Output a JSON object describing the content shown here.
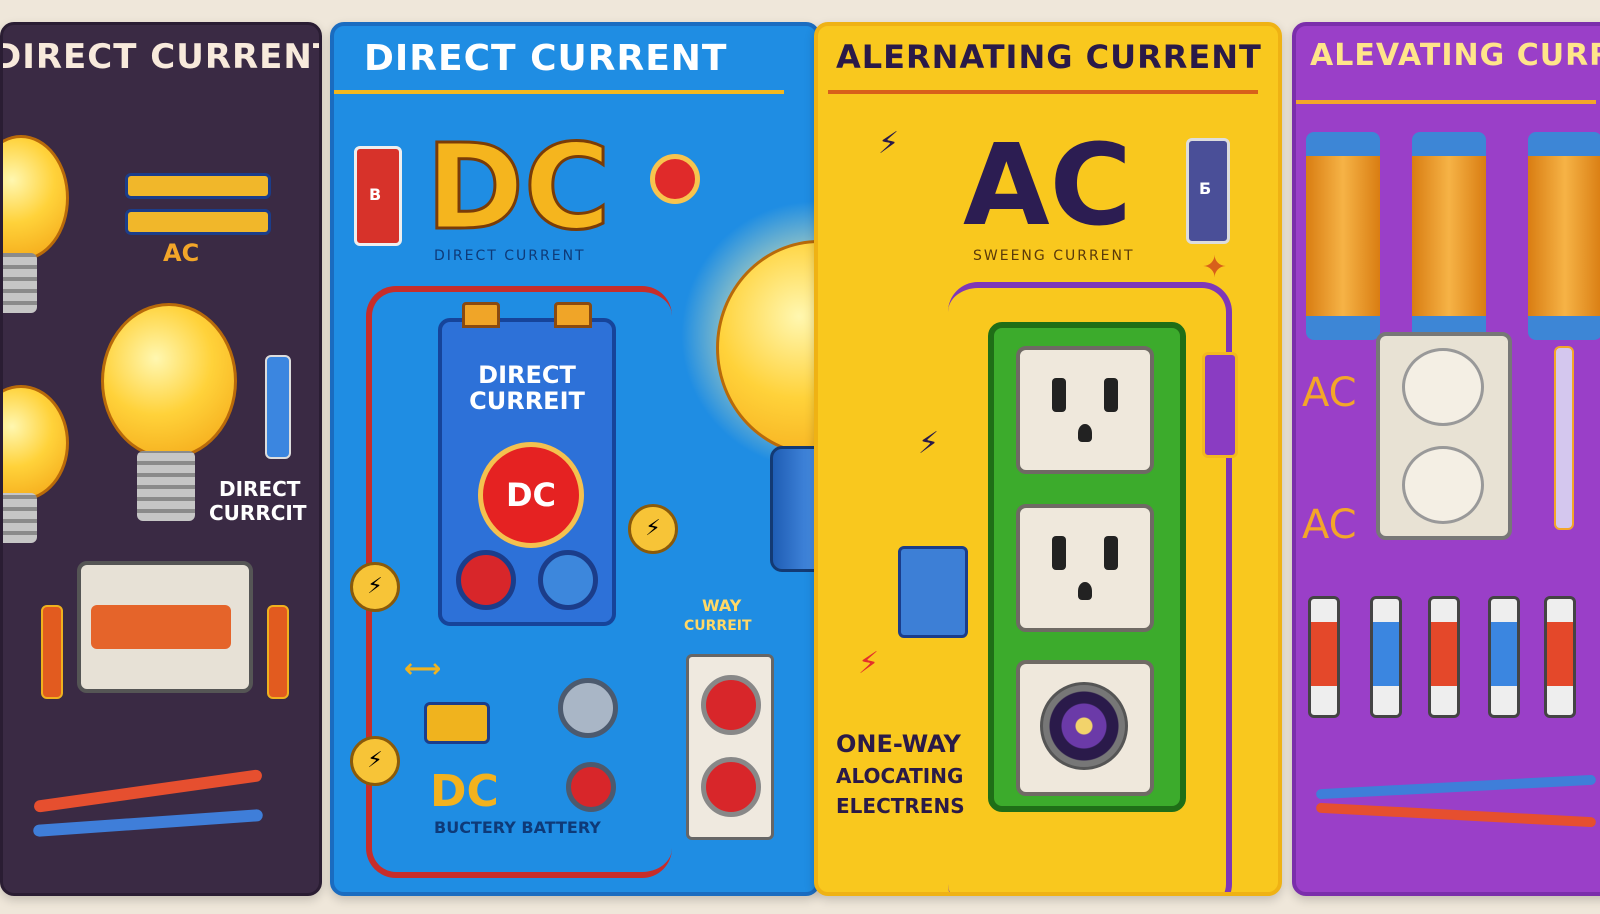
{
  "panels": {
    "p1": {
      "title": "DIRECT CURRENT",
      "label_ac": "AC",
      "label_direct": "DIRECT",
      "label_curr": "CURRCIT"
    },
    "p2": {
      "title": "DIRECT CURRENT",
      "big": "DC",
      "caption": "DIRECT CURRENT",
      "battery_label": "DIRECT CURREIT",
      "button": "DC",
      "way": "WAY",
      "curreit": "CURREIT",
      "bottom_big": "DC",
      "bottom_small": "BUCTERY BATTERY",
      "small_battery_label": "B"
    },
    "p3": {
      "title": "ALERNATING CURRENT",
      "big": "AC",
      "caption": "SWEENG CURRENT",
      "one_way": "ONE-WAY",
      "alocating": "ALOCATING",
      "electrens": "ELECTRENS",
      "small_battery_label": "Б"
    },
    "p4": {
      "title": "ALEVATING CURRE",
      "ac_top": "AC",
      "ac_bottom": "AC"
    }
  },
  "colors": {
    "panel1": "#3a2a44",
    "panel2": "#1f8de3",
    "panel3": "#f9c81e",
    "panel4": "#9a3fc8"
  },
  "icons": [
    "lightbulb-icon",
    "battery-icon",
    "power-outlet-icon",
    "plug-icon",
    "lightning-bolt-icon",
    "cassette-icon",
    "coil-icon"
  ]
}
